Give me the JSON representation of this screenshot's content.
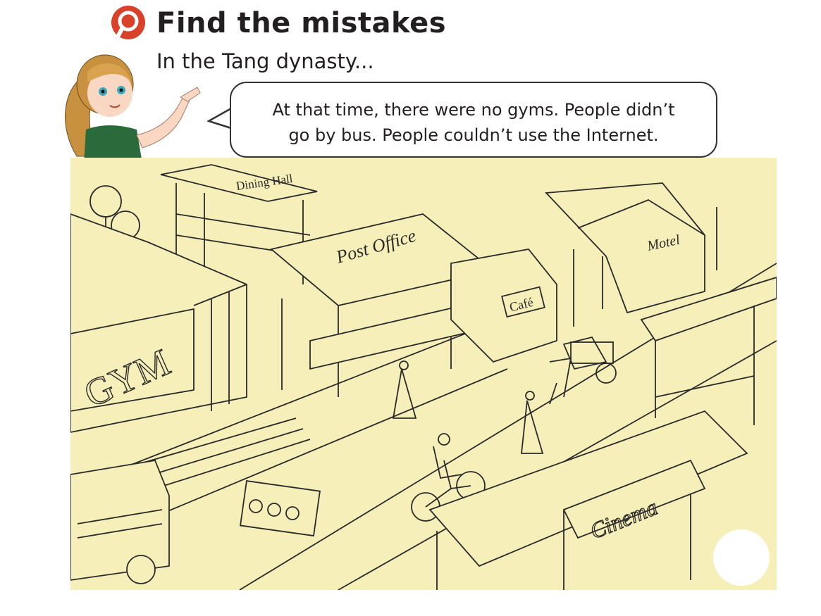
{
  "header": {
    "icon": "magnifier-icon",
    "accent_color": "#d9412b",
    "title": "Find the mistakes",
    "subtitle": "In the Tang dynasty..."
  },
  "speech_bubble": {
    "line1": "At that time, there were no gyms. People didn’t",
    "line2": "go by bus. People couldn’t use the Internet."
  },
  "scene": {
    "background_color": "#f6efb9",
    "signs": {
      "dining_hall": "Dining Hall",
      "post_office": "Post Office",
      "cafe": "Café",
      "motel": "Motel",
      "gym": "GYM",
      "cinema": "Cinema"
    }
  }
}
